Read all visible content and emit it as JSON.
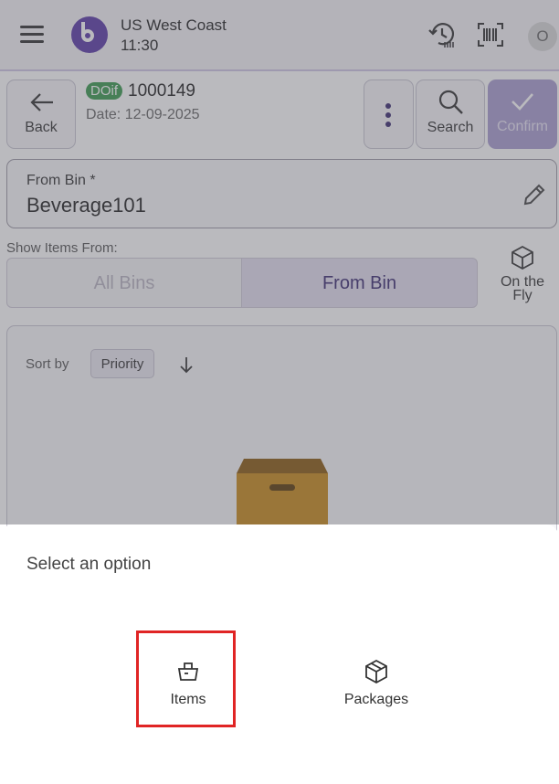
{
  "header": {
    "location": "US West Coast",
    "time": "11:30",
    "avatar_initial": "O"
  },
  "order": {
    "badge": "DOif",
    "number": "1000149",
    "date": "Date: 12-09-2025"
  },
  "actions": {
    "back": "Back",
    "search": "Search",
    "confirm": "Confirm"
  },
  "from_bin": {
    "label": "From Bin *",
    "value": "Beverage101"
  },
  "show_items": {
    "label": "Show Items From:",
    "tabs": [
      "All Bins",
      "From Bin"
    ],
    "selected": "From Bin",
    "on_the_fly_line1": "On the",
    "on_the_fly_line2": "Fly"
  },
  "sort": {
    "label": "Sort by",
    "value": "Priority"
  },
  "sheet": {
    "title": "Select an option",
    "options": [
      {
        "label": "Items",
        "icon": "basket-icon"
      },
      {
        "label": "Packages",
        "icon": "package-icon"
      }
    ]
  },
  "colors": {
    "brand": "#5b3aa8",
    "badge": "#3a9a4f",
    "highlight": "#e02424",
    "box": "#c98a1a"
  }
}
